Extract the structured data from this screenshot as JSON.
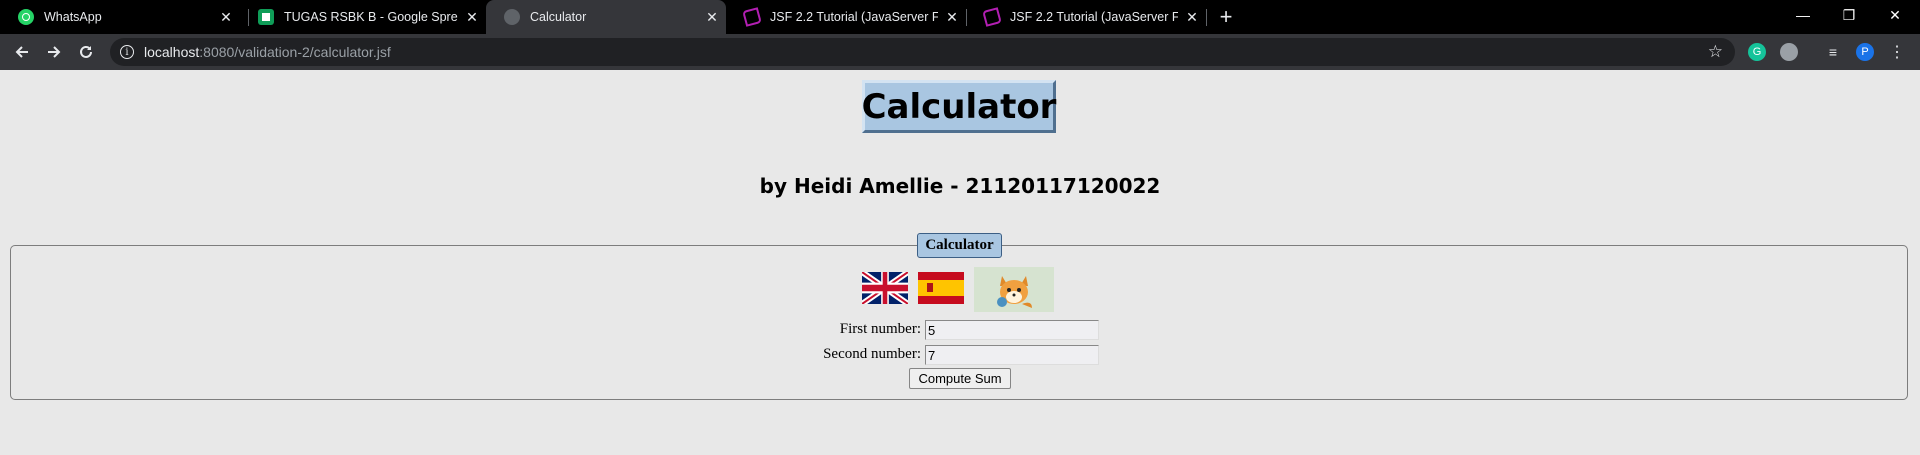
{
  "browser": {
    "tabs": [
      {
        "title": "WhatsApp",
        "favicon": "whatsapp-icon",
        "active": false
      },
      {
        "title": "TUGAS RSBK B - Google Spreadsheet",
        "favicon": "google-sheets-icon",
        "active": false
      },
      {
        "title": "Calculator",
        "favicon": "globe-icon",
        "active": true
      },
      {
        "title": "JSF 2.2 Tutorial (JavaServer Faces)",
        "favicon": "jsf-icon",
        "active": false
      },
      {
        "title": "JSF 2.2 Tutorial (JavaServer Faces)",
        "favicon": "jsf-icon",
        "active": false
      }
    ],
    "tab_close_glyph": "✕",
    "new_tab_glyph": "+",
    "window_controls": {
      "minimize": "—",
      "restore": "❐",
      "close": "✕"
    },
    "address": {
      "host": "localhost",
      "rest": ":8080/validation-2/calculator.jsf"
    },
    "profile_initial": "P",
    "colors": {
      "tabbar": "#000000",
      "toolbar": "#35363a",
      "omnibox": "#202124",
      "profile": "#1a73e8",
      "grammarly": "#15c39a"
    }
  },
  "page": {
    "heading": "Calculator",
    "subtitle": "by Heidi Amellie - 21120117120022",
    "fieldset_legend": "Calculator",
    "form": {
      "first_label": "First number:",
      "first_value": "5",
      "second_label": "Second number:",
      "second_value": "7",
      "submit_label": "Compute Sum"
    },
    "languages": [
      "english-flag-icon",
      "spanish-flag-icon"
    ],
    "mascot": "cartoon-fox-icon",
    "colors": {
      "background": "#e8e8e8",
      "heading_box": "#a9c6e1"
    }
  }
}
